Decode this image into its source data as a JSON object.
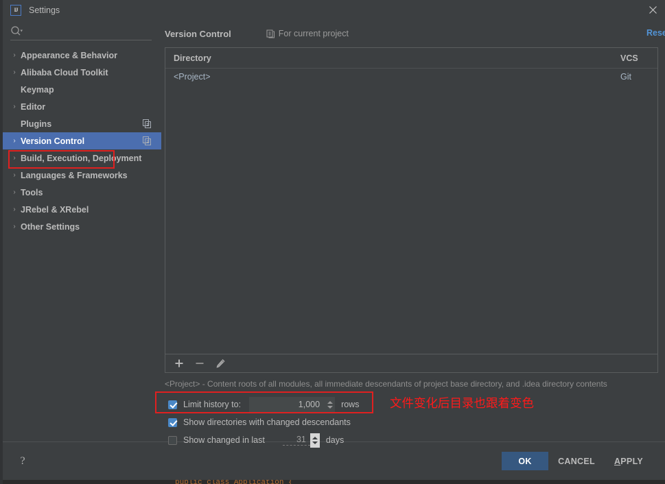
{
  "window": {
    "title": "Settings",
    "logo_text": "IJ",
    "close_icon": "close-icon"
  },
  "sidebar": {
    "search": {
      "value": "",
      "placeholder": "",
      "icon": "search-icon"
    },
    "items": [
      {
        "label": "Appearance & Behavior",
        "arrow": "›",
        "expandable": true,
        "selected": false,
        "copy_icon": false
      },
      {
        "label": "Alibaba Cloud Toolkit",
        "arrow": "›",
        "expandable": true,
        "selected": false,
        "copy_icon": false
      },
      {
        "label": "Keymap",
        "arrow": "",
        "expandable": false,
        "selected": false,
        "copy_icon": false
      },
      {
        "label": "Editor",
        "arrow": "›",
        "expandable": true,
        "selected": false,
        "copy_icon": false
      },
      {
        "label": "Plugins",
        "arrow": "",
        "expandable": false,
        "selected": false,
        "copy_icon": true
      },
      {
        "label": "Version Control",
        "arrow": "›",
        "expandable": true,
        "selected": true,
        "copy_icon": true
      },
      {
        "label": "Build, Execution, Deployment",
        "arrow": "›",
        "expandable": true,
        "selected": false,
        "copy_icon": false
      },
      {
        "label": "Languages & Frameworks",
        "arrow": "›",
        "expandable": true,
        "selected": false,
        "copy_icon": false
      },
      {
        "label": "Tools",
        "arrow": "›",
        "expandable": true,
        "selected": false,
        "copy_icon": false
      },
      {
        "label": "JRebel & XRebel",
        "arrow": "›",
        "expandable": true,
        "selected": false,
        "copy_icon": false
      },
      {
        "label": "Other Settings",
        "arrow": "›",
        "expandable": true,
        "selected": false,
        "copy_icon": false
      }
    ]
  },
  "main": {
    "title": "Version Control",
    "scope_label": "For current project",
    "scope_icon": "project-scope-icon",
    "reset_label": "Reset",
    "table": {
      "columns": [
        "Directory",
        "VCS"
      ],
      "rows": [
        {
          "directory": "<Project>",
          "vcs": "Git"
        }
      ]
    },
    "toolbar": [
      {
        "icon": "add-icon",
        "label": "+"
      },
      {
        "icon": "remove-icon",
        "label": "−"
      },
      {
        "icon": "edit-pencil-icon",
        "label": ""
      }
    ],
    "hint": "<Project> - Content roots of all modules, all immediate descendants of project base directory, and .idea directory contents",
    "options": [
      {
        "id": "limit-history",
        "label": "Limit history to:",
        "checked": true,
        "value": "1,000",
        "unit": "rows",
        "field_style": "boxed"
      },
      {
        "id": "show-changed-descendants",
        "label": "Show directories with changed descendants",
        "checked": true,
        "value": "",
        "unit": "",
        "field_style": "none"
      },
      {
        "id": "show-changed-in-last",
        "label": "Show changed in last",
        "checked": false,
        "value": "31",
        "unit": "days",
        "field_style": "plain"
      }
    ]
  },
  "annotations": {
    "chinese_note": "文件变化后目录也跟着变色",
    "box_color": "#e02020",
    "text_color": "#ff1a1a"
  },
  "footer": {
    "help_label": "?",
    "ok_label": "OK",
    "cancel_label": "CANCEL",
    "apply_label": "APPLY",
    "apply_mnemonic": "A",
    "apply_rest": "PPLY",
    "ok_color": "#365880"
  },
  "background": {
    "code_sliver": "public class Application {"
  }
}
